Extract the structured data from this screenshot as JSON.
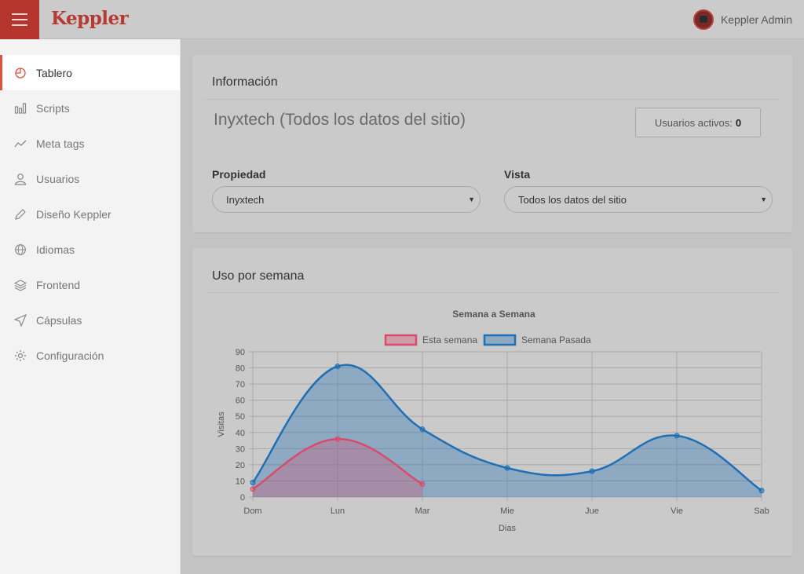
{
  "app": {
    "brand": "Keppler",
    "user_name": "Keppler Admin"
  },
  "sidebar": {
    "items": [
      {
        "label": "Tablero",
        "icon": "pie-chart-icon",
        "active": true
      },
      {
        "label": "Scripts",
        "icon": "bar-chart-icon",
        "active": false
      },
      {
        "label": "Meta tags",
        "icon": "trend-line-icon",
        "active": false
      },
      {
        "label": "Usuarios",
        "icon": "user-icon",
        "active": false
      },
      {
        "label": "Diseño Keppler",
        "icon": "pencil-icon",
        "active": false
      },
      {
        "label": "Idiomas",
        "icon": "globe-icon",
        "active": false
      },
      {
        "label": "Frontend",
        "icon": "layers-icon",
        "active": false
      },
      {
        "label": "Cápsulas",
        "icon": "send-icon",
        "active": false
      },
      {
        "label": "Configuración",
        "icon": "gear-icon",
        "active": false
      }
    ]
  },
  "info_panel": {
    "title": "Información",
    "site_title": "Inyxtech (Todos los datos del sitio)",
    "active_users_label": "Usuarios activos:",
    "active_users_count": "0",
    "property_label": "Propiedad",
    "property_value": "Inyxtech",
    "view_label": "Vista",
    "view_value": "Todos los datos del sitio"
  },
  "chart_panel": {
    "title": "Uso por semana"
  },
  "colors": {
    "brand": "#b5352d",
    "accent": "#e0503f",
    "series_this_week": "#d94b6b",
    "series_last_week": "#1f6fb5"
  },
  "chart_data": {
    "type": "line",
    "title": "Semana a Semana",
    "xlabel": "Dias",
    "ylabel": "Visitas",
    "categories": [
      "Dom",
      "Lun",
      "Mar",
      "Mie",
      "Jue",
      "Vie",
      "Sab"
    ],
    "ylim": [
      0,
      90
    ],
    "yticks": [
      0,
      10,
      20,
      30,
      40,
      50,
      60,
      70,
      80,
      90
    ],
    "legend_position": "top",
    "grid": true,
    "series": [
      {
        "name": "Esta semana",
        "values": [
          5,
          36,
          8
        ],
        "color": "#d94b6b"
      },
      {
        "name": "Semana Pasada",
        "values": [
          9,
          81,
          42,
          18,
          16,
          38,
          4
        ],
        "color": "#1f6fb5"
      }
    ]
  }
}
